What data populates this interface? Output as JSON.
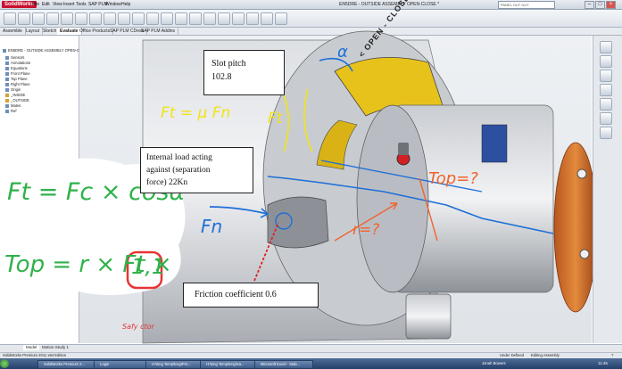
{
  "app": {
    "logo": "SolidWorks",
    "menu": [
      "File",
      "Edit",
      "View",
      "Insert",
      "Tools",
      "SAP PLM",
      "Window",
      "Help"
    ],
    "document_title": "EN5DRE - OUTSIDE ASSEMBLY OPEN-CLOSE *",
    "search_placeholder": "PANEL OUT GUT"
  },
  "tabs": [
    "Assemble",
    "Layout",
    "Sketch",
    "Evaluate",
    "Office Products",
    "SAP PLM CDesk",
    "SAP PLM Addins"
  ],
  "active_tab": "Evaluate",
  "feature_tree": {
    "items": [
      "EN5DRE - OUTSIDE ASSEMBLY OPEN-CLOSE",
      "Sensors",
      "Annotations",
      "Equations",
      "Front Plane",
      "Top Plane",
      "Right Plane",
      "Origin",
      "_INSIDE",
      "_OUTSIDE",
      "Mates",
      "Ref"
    ]
  },
  "annotations": {
    "slot_pitch_label": "Slot pitch",
    "slot_pitch_value": "102.8",
    "load_line1": "Internal  load acting",
    "load_line2": "against  (separation",
    "load_line3": "force) 22Kn",
    "friction_label": "Friction  coefficient  0.6"
  },
  "handwriting": {
    "eq_ft_local": "Ft = μ Fn",
    "ft_label": "Ft",
    "fn_label": "Fn",
    "r_label": "r=?",
    "top_label": "Top=?",
    "alpha": "α",
    "eq_ft_cos": "Ft = Fc × cosα",
    "eq_top": "Top = r × Ft ×",
    "safety_value": "1,1",
    "safety_caption": "Safy ctor"
  },
  "part_label": "< OPEN - CLOSE >",
  "bottom_tabs": [
    "Model",
    "Motion Study 1"
  ],
  "status": {
    "left": "SolidWorks Premium 2011 x64 Edition",
    "right1": "Under Defined",
    "right2": "Editing Assembly",
    "help": "?"
  },
  "taskbar": {
    "items": [
      "SolidWorks Premium 2...",
      "Login",
      "H:\\Eng Temp\\Eng\\Pro...",
      "H:\\Eng Temp\\Eng\\Sa...",
      "Microsoft Excel - Stab..."
    ],
    "user": "Jonah Bowers",
    "clock": "11:45"
  },
  "colors": {
    "accent_red": "#c8102e",
    "ink_blue": "#1e6fd8",
    "ink_green": "#2fb24a",
    "ink_orange": "#f0642d",
    "ink_yellow": "#f2e414",
    "part_yellow": "#e7c21b"
  }
}
